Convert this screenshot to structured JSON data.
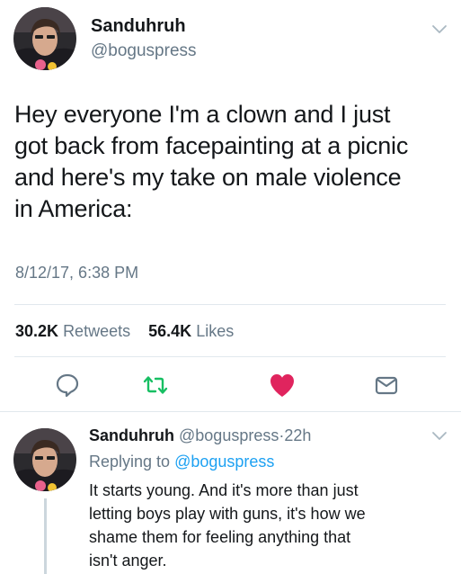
{
  "tweet": {
    "author_name": "Sanduhruh",
    "author_handle": "@boguspress",
    "text_lines": [
      "Hey everyone I'm a clown and I just",
      "got back from facepainting at a picnic",
      "and here's my take on male violence",
      "in America:"
    ],
    "timestamp": "8/12/17, 6:38 PM",
    "retweets_count": "30.2K",
    "retweets_label": "Retweets",
    "likes_count": "56.4K",
    "likes_label": "Likes",
    "liked": true
  },
  "icons": {
    "caret": "chevron-down-icon",
    "reply": "reply-icon",
    "retweet": "retweet-icon",
    "like": "heart-icon",
    "message": "envelope-icon"
  },
  "colors": {
    "like_active": "#e0245e",
    "retweet": "#17bf63",
    "link": "#1da1f2",
    "secondary_text": "#657786"
  },
  "reply": {
    "author_name": "Sanduhruh",
    "author_handle": "@boguspress",
    "separator": "·",
    "time": "22h",
    "replying_prefix": "Replying to",
    "replying_to": "@boguspress",
    "text_lines": [
      "It starts young. And it's more than just",
      "letting boys play with guns, it's how we",
      "shame them for feeling anything that",
      "isn't anger."
    ]
  }
}
